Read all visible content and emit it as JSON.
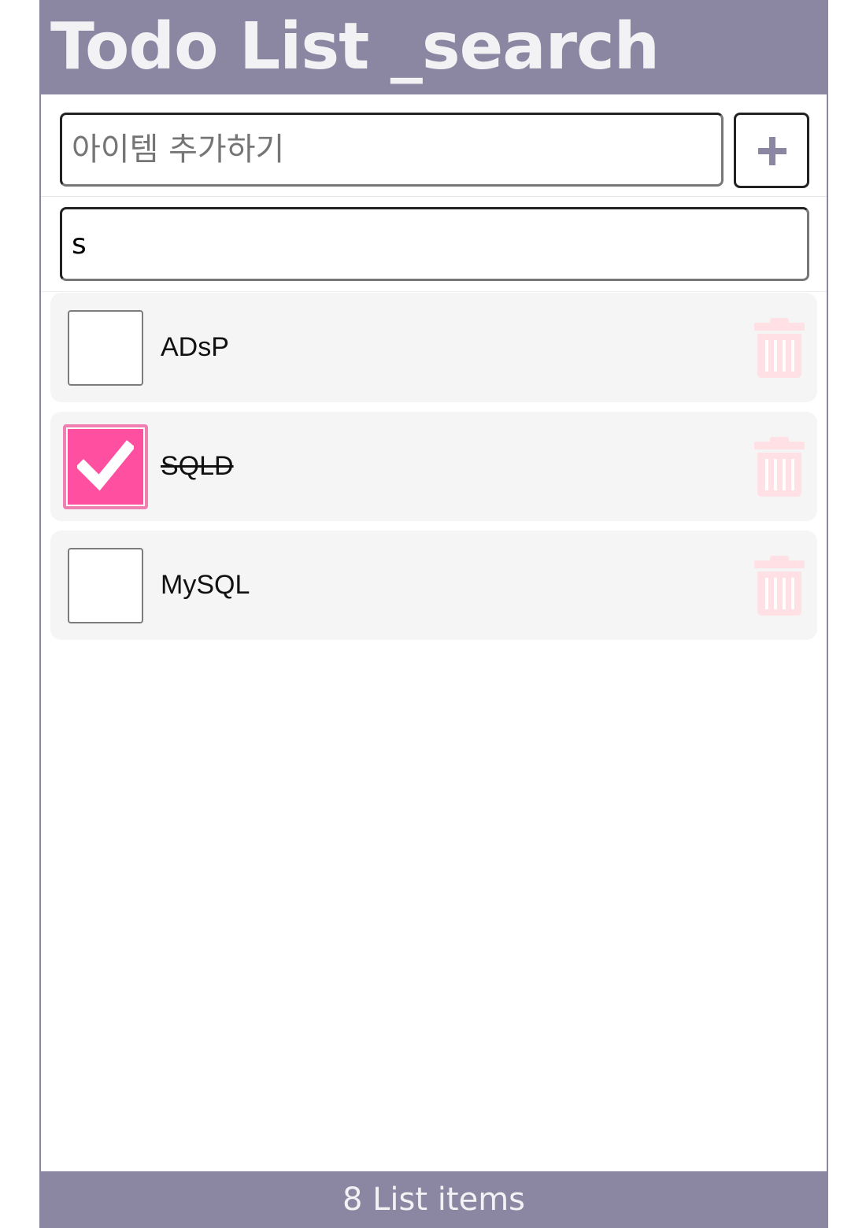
{
  "header": {
    "title": "Todo List _search"
  },
  "add_form": {
    "placeholder": "아이템 추가하기",
    "value": "",
    "add_button_icon": "plus-icon"
  },
  "search": {
    "value": "s"
  },
  "todos": [
    {
      "text": "ADsP",
      "checked": false
    },
    {
      "text": "SQLD",
      "checked": true
    },
    {
      "text": "MySQL",
      "checked": false
    }
  ],
  "footer": {
    "count_text": "8 List items"
  },
  "colors": {
    "header_bg": "#8b87a3",
    "checked_pink": "#ff4fa0",
    "trash_pink": "#ffe0e4",
    "item_bg": "#f5f5f5"
  }
}
